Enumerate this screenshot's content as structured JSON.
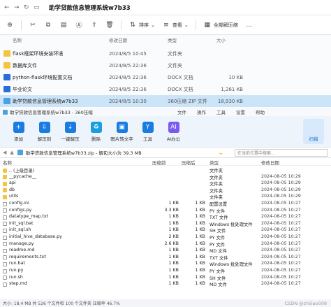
{
  "explorer": {
    "title": "助学贷款信息管理系统w7b33",
    "toolbar": {
      "sort": "排序",
      "view": "查看",
      "extract_all": "全部解压缩"
    },
    "columns": {
      "name": "名称",
      "date": "修改日期",
      "type": "类型",
      "size": "大小"
    },
    "rows": [
      {
        "name": "flask框架环境安装环境",
        "date": "2024/8/5 10:45",
        "type": "文件夹",
        "size": "",
        "kind": "folder"
      },
      {
        "name": "数据库文件",
        "date": "2024/8/5 22:36",
        "type": "文件夹",
        "size": "",
        "kind": "folder"
      },
      {
        "name": "python-flask环境配置文档",
        "date": "2024/8/5 22:36",
        "type": "DOCX 文档",
        "size": "10 KB",
        "kind": "docx"
      },
      {
        "name": "毕业论文",
        "date": "2024/8/5 22:36",
        "type": "DOCX 文档",
        "size": "1,261 KB",
        "kind": "docx"
      },
      {
        "name": "助学贷款信息管理系统w7b33",
        "date": "2024/8/5 10:30",
        "type": "360压缩 ZIP 文件",
        "size": "18,930 KB",
        "kind": "zip"
      }
    ]
  },
  "zip": {
    "title": "助学贷款信息管理系统w7b33 - 360压缩",
    "menu": [
      "文件",
      "操作",
      "工具",
      "设置",
      "帮助"
    ],
    "tools": [
      {
        "label": "添加",
        "icon": "add-icon",
        "color": "#1a7be0"
      },
      {
        "label": "解压到",
        "icon": "extract-icon",
        "color": "#1a7be0"
      },
      {
        "label": "一键解压",
        "icon": "one-click-extract-icon",
        "color": "#1a7be0"
      },
      {
        "label": "删除",
        "icon": "delete-icon",
        "color": "#1a9ee0"
      },
      {
        "label": "图片转文字",
        "icon": "image-to-text-icon",
        "color": "#1a7be0"
      },
      {
        "label": "工具",
        "icon": "tools-icon",
        "color": "#1a7be0"
      },
      {
        "label": "AI办公",
        "icon": "ai-icon",
        "color": "#7a5af0"
      }
    ],
    "scan_label": "扫描",
    "path_text": "助学贷款信息管理系统w7b33.zip - 解包大小为 39.3 MB",
    "search_placeholder": "在当前位置中搜索...",
    "columns": {
      "name": "名称",
      "compressed": "压缩前",
      "packed": "压缩后",
      "type": "类型",
      "modified": "修改日期"
    },
    "rows": [
      {
        "name": ".. (上级目录)",
        "compressed": "",
        "packed": "",
        "type": "文件夹",
        "modified": "",
        "kind": "folder"
      },
      {
        "name": "__pycache__",
        "compressed": "",
        "packed": "",
        "type": "文件夹",
        "modified": "2024-08-05 10:29",
        "kind": "folder"
      },
      {
        "name": "api",
        "compressed": "",
        "packed": "",
        "type": "文件夹",
        "modified": "2024-08-05 10:29",
        "kind": "folder"
      },
      {
        "name": "db",
        "compressed": "",
        "packed": "",
        "type": "文件夹",
        "modified": "2024-08-05 10:29",
        "kind": "folder"
      },
      {
        "name": "utils",
        "compressed": "",
        "packed": "",
        "type": "文件夹",
        "modified": "2024-08-05 10:29",
        "kind": "folder"
      },
      {
        "name": "config.ini",
        "compressed": "1 KB",
        "packed": "1 KB",
        "type": "配置设置",
        "modified": "2024-08-05 10:27",
        "kind": "file"
      },
      {
        "name": "configs.py",
        "compressed": "3.3 KB",
        "packed": "1 KB",
        "type": "PY 文件",
        "modified": "2024-08-05 10:27",
        "kind": "file"
      },
      {
        "name": "datatype_map.txt",
        "compressed": "1 KB",
        "packed": "1 KB",
        "type": "TXT 文件",
        "modified": "2024-08-05 10:27",
        "kind": "file"
      },
      {
        "name": "init_sql.bat",
        "compressed": "1 KB",
        "packed": "1 KB",
        "type": "Windows 批处理文件",
        "modified": "2024-08-05 10:27",
        "kind": "file"
      },
      {
        "name": "init_sql.sh",
        "compressed": "1 KB",
        "packed": "1 KB",
        "type": "SH 文件",
        "modified": "2024-08-05 10:27",
        "kind": "file"
      },
      {
        "name": "initial_hive_database.py",
        "compressed": "2 KB",
        "packed": "1 KB",
        "type": "PY 文件",
        "modified": "2024-08-05 10:27",
        "kind": "file"
      },
      {
        "name": "manage.py",
        "compressed": "2.6 KB",
        "packed": "1 KB",
        "type": "PY 文件",
        "modified": "2024-08-05 10:27",
        "kind": "file"
      },
      {
        "name": "readme.md",
        "compressed": "1 KB",
        "packed": "1 KB",
        "type": "MD 文件",
        "modified": "2024-08-05 10:27",
        "kind": "file"
      },
      {
        "name": "requirements.txt",
        "compressed": "1 KB",
        "packed": "1 KB",
        "type": "TXT 文件",
        "modified": "2024-08-05 10:27",
        "kind": "file"
      },
      {
        "name": "run.bat",
        "compressed": "1 KB",
        "packed": "1 KB",
        "type": "Windows 批处理文件",
        "modified": "2024-08-05 10:27",
        "kind": "file"
      },
      {
        "name": "run.py",
        "compressed": "1 KB",
        "packed": "1 KB",
        "type": "PY 文件",
        "modified": "2024-08-05 10:27",
        "kind": "file"
      },
      {
        "name": "run.sh",
        "compressed": "1 KB",
        "packed": "1 KB",
        "type": "SH 文件",
        "modified": "2024-08-05 10:27",
        "kind": "file"
      },
      {
        "name": "step.md",
        "compressed": "1 KB",
        "packed": "1 KB",
        "type": "MD 文件",
        "modified": "2024-08-05 10:27",
        "kind": "file"
      }
    ],
    "status": "大小: 18.4 MB 共 526 个文件和 100 个文件夹 压缩率 46.7%"
  },
  "watermark": "CSDN @zhiiiao508"
}
